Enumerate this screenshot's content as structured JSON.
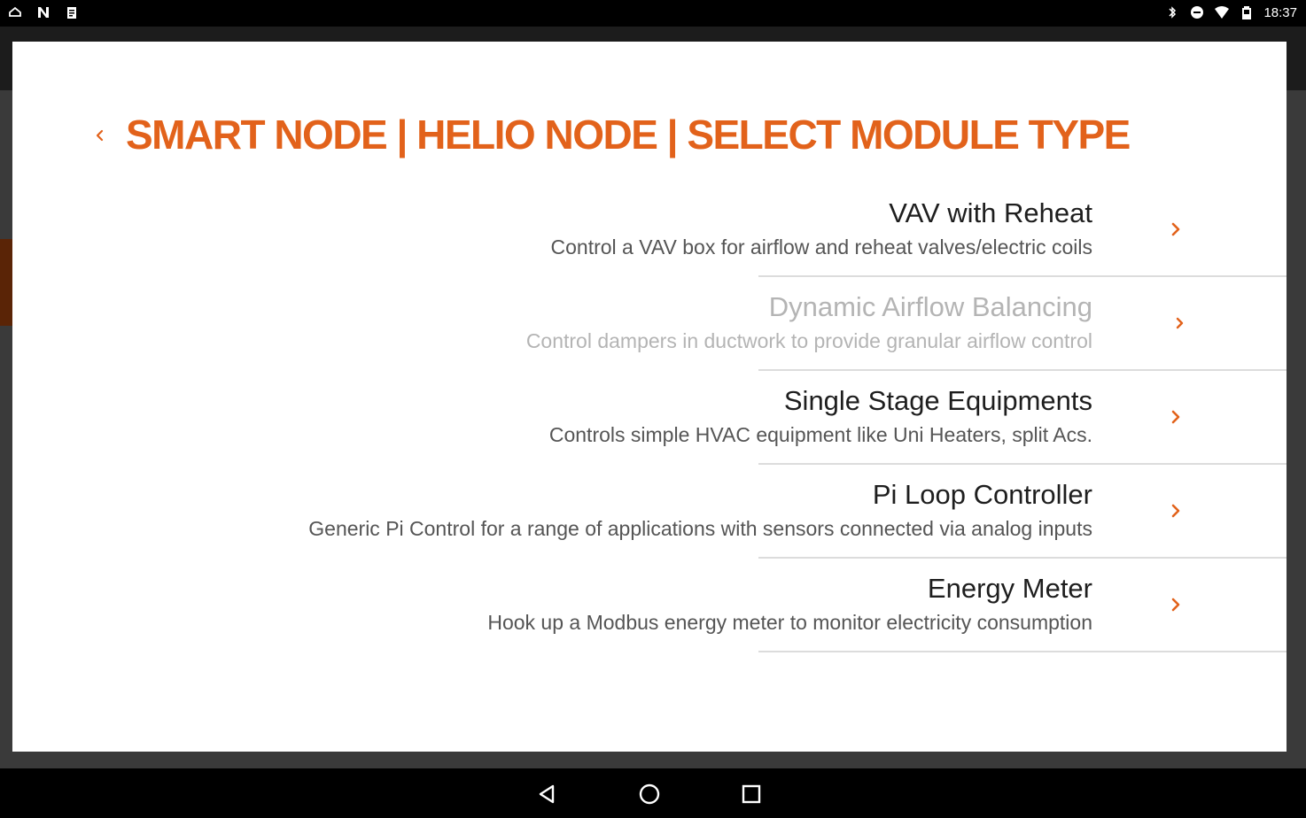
{
  "status_bar": {
    "time": "18:37",
    "left_icons": [
      "cloud-icon",
      "n-logo-icon",
      "clipboard-icon"
    ],
    "right_icons": [
      "bluetooth-icon",
      "do-not-disturb-icon",
      "wifi-icon",
      "battery-icon"
    ]
  },
  "dialog": {
    "title": "SMART NODE | HELIO NODE | SELECT MODULE TYPE",
    "back_icon": "chevron-left-icon"
  },
  "modules": [
    {
      "name": "VAV with Reheat",
      "description": "Control a VAV box for airflow and reheat valves/electric coils",
      "enabled": true
    },
    {
      "name": "Dynamic Airflow Balancing",
      "description": "Control dampers in ductwork to provide granular airflow control",
      "enabled": false
    },
    {
      "name": "Single Stage Equipments",
      "description": "Controls simple HVAC equipment like Uni Heaters, split Acs.",
      "enabled": true
    },
    {
      "name": "Pi Loop Controller",
      "description": "Generic Pi Control for a range of applications with sensors connected via analog inputs",
      "enabled": true
    },
    {
      "name": "Energy Meter",
      "description": "Hook up a Modbus energy meter to monitor electricity consumption",
      "enabled": true
    }
  ],
  "nav_bar": {
    "icons": [
      "back-triangle-icon",
      "home-circle-icon",
      "recents-square-icon"
    ]
  },
  "colors": {
    "accent": "#e2621b",
    "disabled_text": "#b4b4b4",
    "divider": "#dcdcdc"
  }
}
